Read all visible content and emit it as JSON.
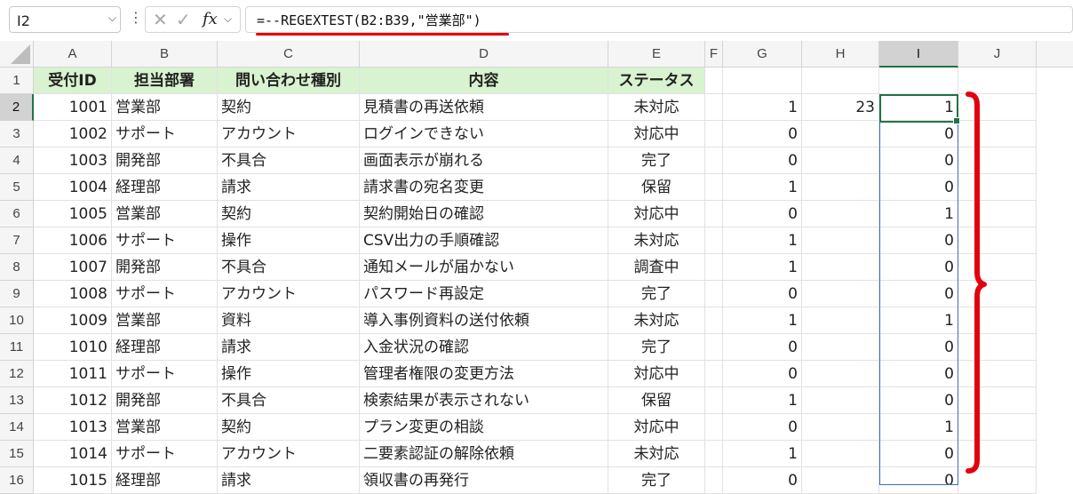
{
  "name_box": {
    "value": "I2"
  },
  "formula_bar": {
    "formula": "=--REGEXTEST(B2:B39,\"営業部\")"
  },
  "columns": [
    "A",
    "B",
    "C",
    "D",
    "E",
    "F",
    "G",
    "H",
    "I",
    "J"
  ],
  "header_row": {
    "row": "1",
    "a": "受付ID",
    "b": "担当部署",
    "c": "問い合わせ種別",
    "d": "内容",
    "e": "ステータス"
  },
  "rows": [
    {
      "row": "2",
      "id": "1001",
      "dept": "営業部",
      "type": "契約",
      "content": "見積書の再送依頼",
      "status": "未対応",
      "g": "1",
      "h": "23",
      "i": "1"
    },
    {
      "row": "3",
      "id": "1002",
      "dept": "サポート",
      "type": "アカウント",
      "content": "ログインできない",
      "status": "対応中",
      "g": "0",
      "h": "",
      "i": "0"
    },
    {
      "row": "4",
      "id": "1003",
      "dept": "開発部",
      "type": "不具合",
      "content": "画面表示が崩れる",
      "status": "完了",
      "g": "0",
      "h": "",
      "i": "0"
    },
    {
      "row": "5",
      "id": "1004",
      "dept": "経理部",
      "type": "請求",
      "content": "請求書の宛名変更",
      "status": "保留",
      "g": "1",
      "h": "",
      "i": "0"
    },
    {
      "row": "6",
      "id": "1005",
      "dept": "営業部",
      "type": "契約",
      "content": "契約開始日の確認",
      "status": "対応中",
      "g": "0",
      "h": "",
      "i": "1"
    },
    {
      "row": "7",
      "id": "1006",
      "dept": "サポート",
      "type": "操作",
      "content": "CSV出力の手順確認",
      "status": "未対応",
      "g": "1",
      "h": "",
      "i": "0"
    },
    {
      "row": "8",
      "id": "1007",
      "dept": "開発部",
      "type": "不具合",
      "content": "通知メールが届かない",
      "status": "調査中",
      "g": "1",
      "h": "",
      "i": "0"
    },
    {
      "row": "9",
      "id": "1008",
      "dept": "サポート",
      "type": "アカウント",
      "content": "パスワード再設定",
      "status": "完了",
      "g": "0",
      "h": "",
      "i": "0"
    },
    {
      "row": "10",
      "id": "1009",
      "dept": "営業部",
      "type": "資料",
      "content": "導入事例資料の送付依頼",
      "status": "未対応",
      "g": "1",
      "h": "",
      "i": "1"
    },
    {
      "row": "11",
      "id": "1010",
      "dept": "経理部",
      "type": "請求",
      "content": "入金状況の確認",
      "status": "完了",
      "g": "0",
      "h": "",
      "i": "0"
    },
    {
      "row": "12",
      "id": "1011",
      "dept": "サポート",
      "type": "操作",
      "content": "管理者権限の変更方法",
      "status": "対応中",
      "g": "0",
      "h": "",
      "i": "0"
    },
    {
      "row": "13",
      "id": "1012",
      "dept": "開発部",
      "type": "不具合",
      "content": "検索結果が表示されない",
      "status": "保留",
      "g": "1",
      "h": "",
      "i": "0"
    },
    {
      "row": "14",
      "id": "1013",
      "dept": "営業部",
      "type": "契約",
      "content": "プラン変更の相談",
      "status": "対応中",
      "g": "0",
      "h": "",
      "i": "1"
    },
    {
      "row": "15",
      "id": "1014",
      "dept": "サポート",
      "type": "アカウント",
      "content": "二要素認証の解除依頼",
      "status": "未対応",
      "g": "1",
      "h": "",
      "i": "0"
    },
    {
      "row": "16",
      "id": "1015",
      "dept": "経理部",
      "type": "請求",
      "content": "領収書の再発行",
      "status": "完了",
      "g": "0",
      "h": "",
      "i": "0"
    }
  ],
  "colors": {
    "header_fill": "#d9f2d0",
    "selection": "#217346",
    "annotation_brace": "#e3000e",
    "formula_underline": "#e3000e"
  },
  "icons": {
    "dropdown": "chevron-down-icon",
    "cancel": "close-icon",
    "enter": "checkmark-icon",
    "insert_function": "fx-icon",
    "more": "kebab-icon"
  }
}
